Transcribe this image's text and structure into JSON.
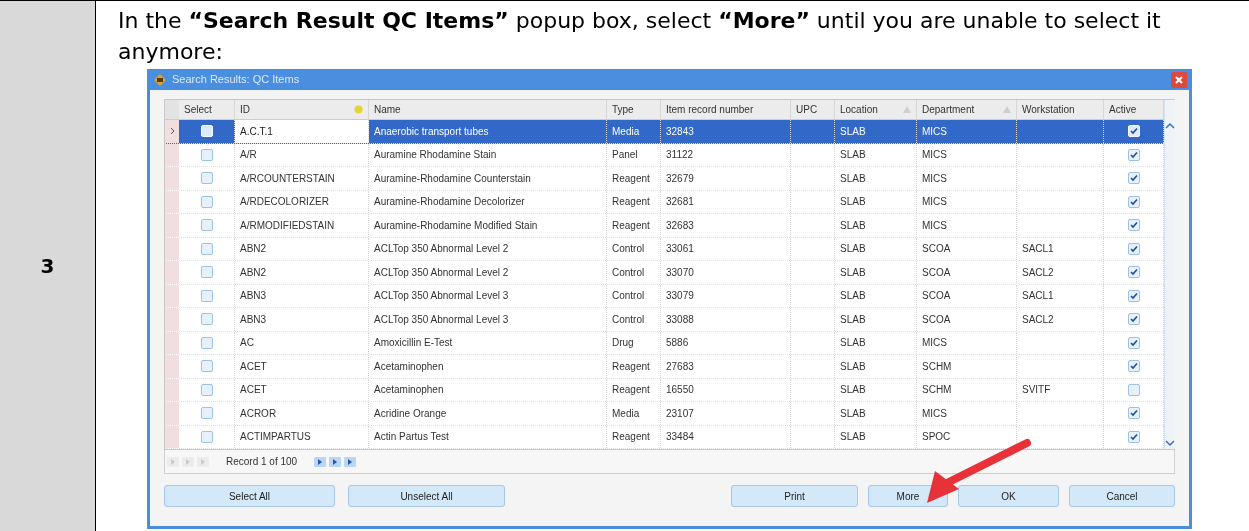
{
  "step": {
    "number": "3",
    "instruction": "In the **“Search Result QC Items”** popup box, select **“More”** until you are unable to select it anymore:"
  },
  "dialog": {
    "title": "Search Results: QC Items",
    "columns": [
      "Select",
      "ID",
      "Name",
      "Type",
      "Item record number",
      "UPC",
      "Location",
      "Department",
      "Workstation",
      "Active"
    ],
    "rows": [
      {
        "selected": true,
        "checked": false,
        "id": "A.C.T.1",
        "name": "Anaerobic transport tubes",
        "type": "Media",
        "record": "32843",
        "location": "SLAB",
        "department": "MICS",
        "workstation": "",
        "active": true
      },
      {
        "selected": false,
        "checked": false,
        "id": "A/R",
        "name": "Auramine Rhodamine Stain",
        "type": "Panel",
        "record": "31122",
        "location": "SLAB",
        "department": "MICS",
        "workstation": "",
        "active": true
      },
      {
        "selected": false,
        "checked": false,
        "id": "A/RCOUNTERSTAIN",
        "name": "Auramine-Rhodamine Counterstain",
        "type": "Reagent",
        "record": "32679",
        "location": "SLAB",
        "department": "MICS",
        "workstation": "",
        "active": true
      },
      {
        "selected": false,
        "checked": false,
        "id": "A/RDECOLORIZER",
        "name": "Auramine-Rhodamine Decolorizer",
        "type": "Reagent",
        "record": "32681",
        "location": "SLAB",
        "department": "MICS",
        "workstation": "",
        "active": true
      },
      {
        "selected": false,
        "checked": false,
        "id": "A/RMODIFIEDSTAIN",
        "name": "Auramine-Rhodamine Modified Stain",
        "type": "Reagent",
        "record": "32683",
        "location": "SLAB",
        "department": "MICS",
        "workstation": "",
        "active": true
      },
      {
        "selected": false,
        "checked": false,
        "id": "ABN2",
        "name": "ACLTop 350 Abnormal Level 2",
        "type": "Control",
        "record": "33061",
        "location": "SLAB",
        "department": "SCOA",
        "workstation": "SACL1",
        "active": true
      },
      {
        "selected": false,
        "checked": false,
        "id": "ABN2",
        "name": "ACLTop 350 Abnormal Level 2",
        "type": "Control",
        "record": "33070",
        "location": "SLAB",
        "department": "SCOA",
        "workstation": "SACL2",
        "active": true
      },
      {
        "selected": false,
        "checked": false,
        "id": "ABN3",
        "name": "ACLTop 350 Abnormal Level 3",
        "type": "Control",
        "record": "33079",
        "location": "SLAB",
        "department": "SCOA",
        "workstation": "SACL1",
        "active": true
      },
      {
        "selected": false,
        "checked": false,
        "id": "ABN3",
        "name": "ACLTop 350 Abnormal Level 3",
        "type": "Control",
        "record": "33088",
        "location": "SLAB",
        "department": "SCOA",
        "workstation": "SACL2",
        "active": true
      },
      {
        "selected": false,
        "checked": false,
        "id": "AC",
        "name": "Amoxicillin E-Test",
        "type": "Drug",
        "record": "5886",
        "location": "SLAB",
        "department": "MICS",
        "workstation": "",
        "active": true
      },
      {
        "selected": false,
        "checked": false,
        "id": "ACET",
        "name": "Acetaminophen",
        "type": "Reagent",
        "record": "27683",
        "location": "SLAB",
        "department": "SCHM",
        "workstation": "",
        "active": true
      },
      {
        "selected": false,
        "checked": false,
        "id": "ACET",
        "name": "Acetaminophen",
        "type": "Reagent",
        "record": "16550",
        "location": "SLAB",
        "department": "SCHM",
        "workstation": "SVITF",
        "active": false
      },
      {
        "selected": false,
        "checked": false,
        "id": "ACROR",
        "name": "Acridine Orange",
        "type": "Media",
        "record": "23107",
        "location": "SLAB",
        "department": "MICS",
        "workstation": "",
        "active": true
      },
      {
        "selected": false,
        "checked": false,
        "id": "ACTIMPARTUS",
        "name": "Actin Partus Test",
        "type": "Reagent",
        "record": "33484",
        "location": "SLAB",
        "department": "SPOC",
        "workstation": "",
        "active": true
      }
    ],
    "record_status": "Record 1 of 100",
    "left_buttons": [
      "Select All",
      "Unselect All"
    ],
    "right_buttons": [
      "Print",
      "More",
      "OK",
      "Cancel"
    ]
  }
}
